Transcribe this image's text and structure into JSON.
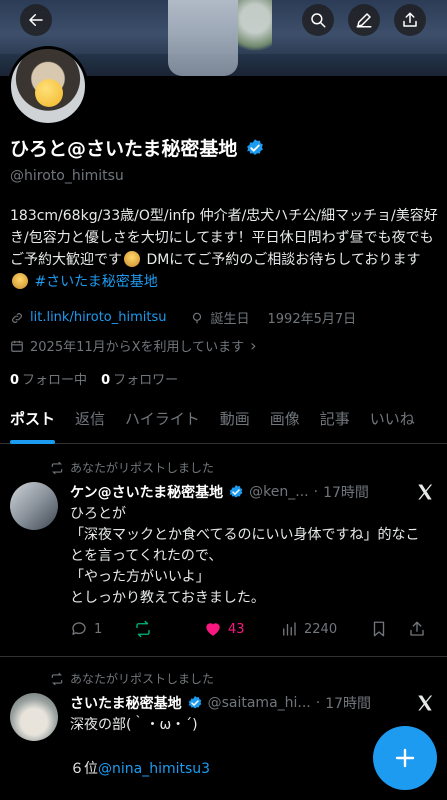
{
  "profile": {
    "name": "ひろと@さいたま秘密基地",
    "handle": "@hiroto_himitsu",
    "bio_main": "183cm/68kg/33歳/O型/infp 仲介者/忠犬ハチ公/細マッチョ/美容好き/包容力と優しさを大切にしてます！平日休日問わず昼でも夜でもご予約大歓迎です",
    "bio_mid": " DMにてご予約のご相談お待ちしております",
    "bio_tag": "#さいたま秘密基地",
    "link": "lit.link/hiroto_himitsu",
    "birthday_label": "誕生日",
    "birthday": "1992年5月7日",
    "joined": "2025年11月からXを利用しています",
    "following_count": "0",
    "following_label": "フォロー中",
    "followers_count": "0",
    "followers_label": "フォロワー"
  },
  "tabs": [
    "ポスト",
    "返信",
    "ハイライト",
    "動画",
    "画像",
    "記事",
    "いいね"
  ],
  "posts": [
    {
      "repost_label": "あなたがリポストしました",
      "name": "ケン@さいたま秘密基地",
      "handle": "@ken_...",
      "time": "17時間",
      "text": "ひろとが\n「深夜マックとか食べてるのにいい身体ですね」的なことを言ってくれたので、\n「やった方がいいよ」\nとしっかり教えておきました。",
      "replies": "1",
      "likes": "43",
      "views": "2240"
    },
    {
      "repost_label": "あなたがリポストしました",
      "name": "さいたま秘密基地",
      "handle": "@saitama_hi...",
      "time": "17時間",
      "text": "深夜の部(｀・ω・´)",
      "rank": "６位",
      "mention": "@nina_himitsu3"
    }
  ],
  "colors": {
    "accent": "#1d9bf0",
    "like": "#f91880",
    "repost": "#00ba7c",
    "muted": "#71767b"
  },
  "icons": [
    "back-arrow-icon",
    "search-icon",
    "edit-icon",
    "share-icon",
    "verified-icon",
    "link-icon",
    "balloon-icon",
    "calendar-icon",
    "repost-icon",
    "reply-icon",
    "heart-icon",
    "views-icon",
    "bookmark-icon",
    "x-logo-icon",
    "plus-icon"
  ]
}
